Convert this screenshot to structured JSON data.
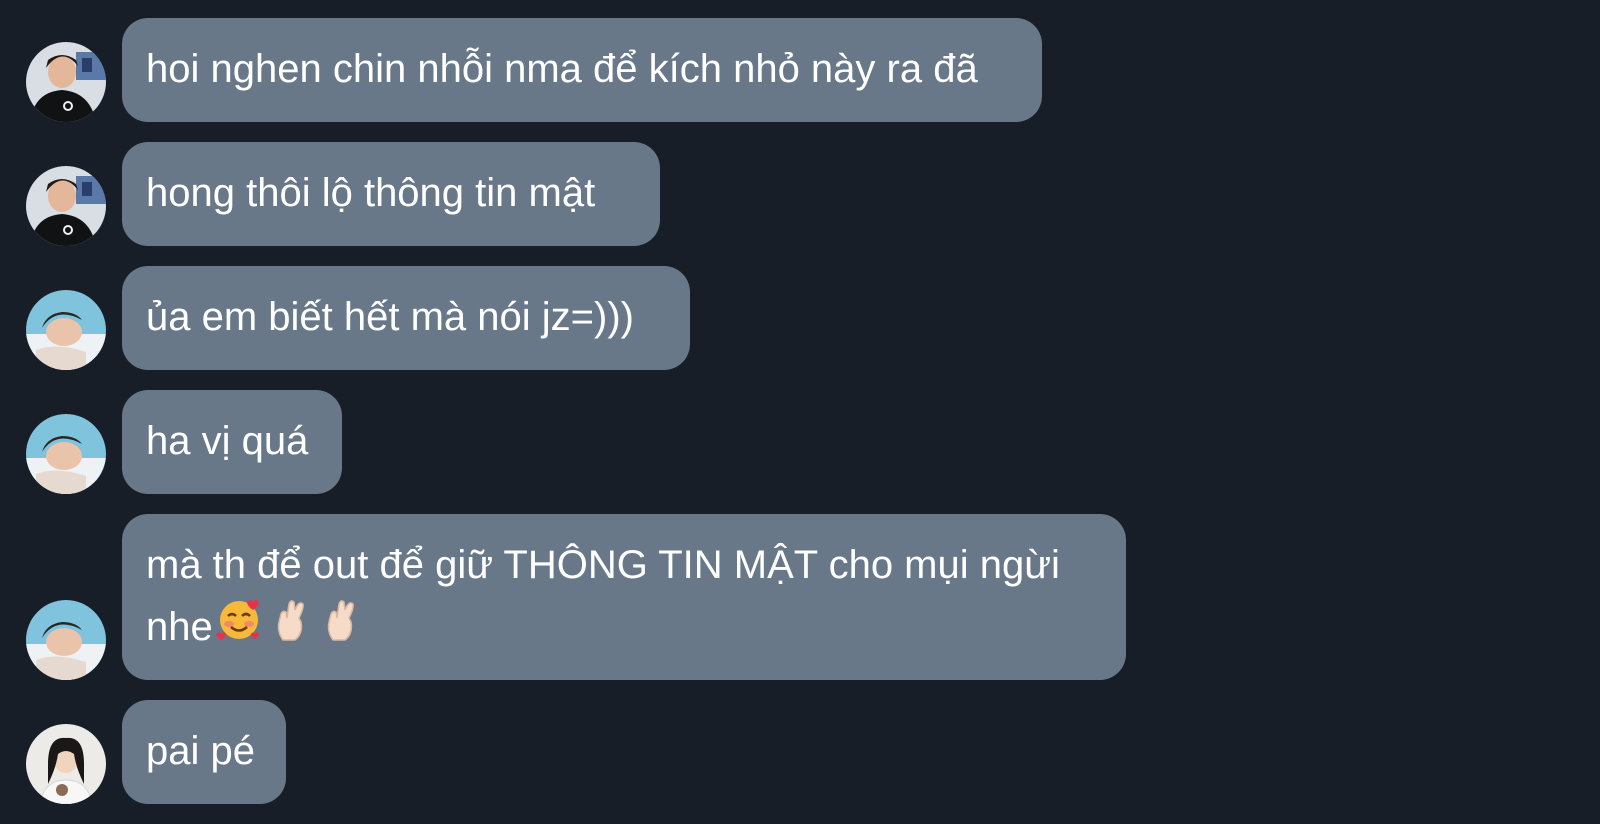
{
  "messages": [
    {
      "sender": "user-a",
      "text": "hoi nghen chin nhỗi nma để kích nhỏ này ra đã"
    },
    {
      "sender": "user-a",
      "text": "hong thôi lộ thông tin mật"
    },
    {
      "sender": "user-b",
      "text": "ủa em biết hết mà nói jz=)))"
    },
    {
      "sender": "user-b",
      "text": "ha vị quá"
    },
    {
      "sender": "user-b",
      "line1": "mà th để out để giữ THÔNG TIN MẬT cho mụi ngừi",
      "line2": "nhe",
      "emojis": [
        "smiling-face-with-hearts-icon",
        "crossed-fingers-icon",
        "crossed-fingers-icon"
      ]
    },
    {
      "sender": "user-c",
      "text": "pai pé"
    }
  ],
  "colors": {
    "background": "#171e28",
    "bubble": "#687888",
    "text": "#ffffff"
  }
}
